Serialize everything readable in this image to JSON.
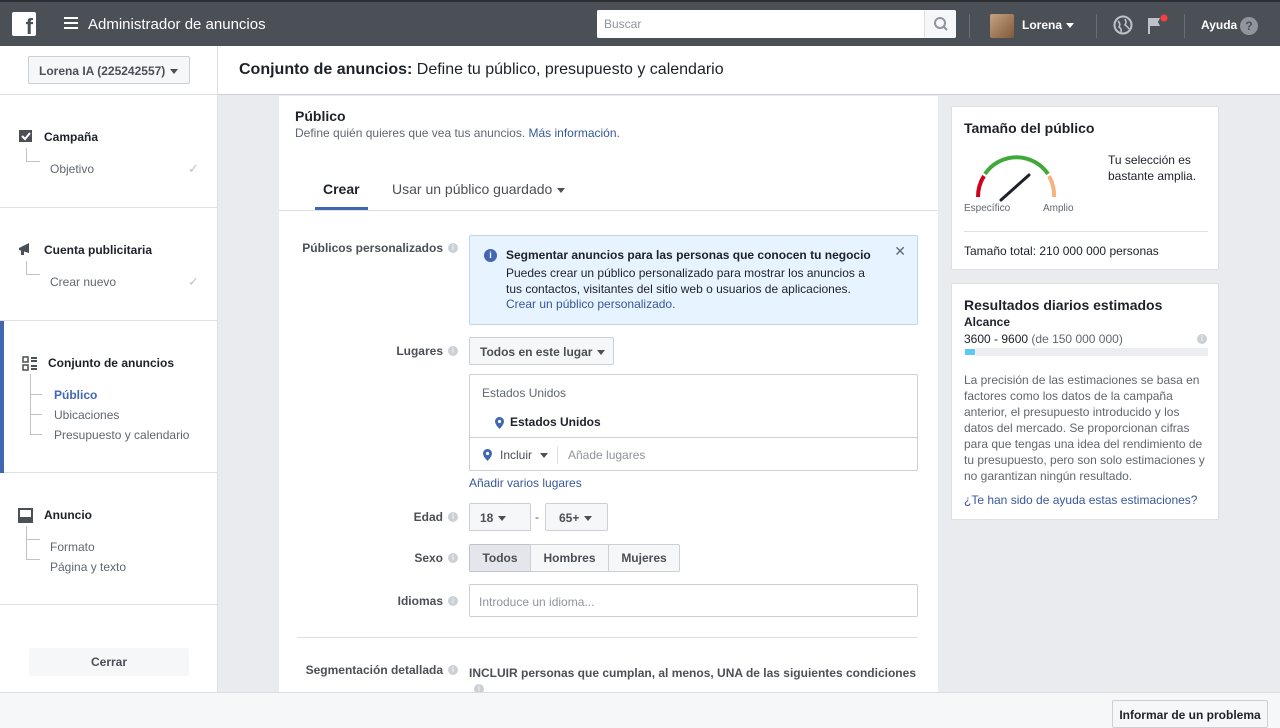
{
  "topbar": {
    "logo": "f",
    "title": "Administrador de anuncios",
    "search_placeholder": "Buscar",
    "user_name": "Lorena",
    "help_label": "Ayuda"
  },
  "sidebar": {
    "account": "Lorena IA (225242557)",
    "sections": [
      {
        "title": "Campaña",
        "items": [
          {
            "label": "Objetivo",
            "done": true
          }
        ]
      },
      {
        "title": "Cuenta publicitaria",
        "items": [
          {
            "label": "Crear nuevo",
            "done": true
          }
        ]
      },
      {
        "title": "Conjunto de anuncios",
        "items": [
          {
            "label": "Público",
            "active": true
          },
          {
            "label": "Ubicaciones"
          },
          {
            "label": "Presupuesto y calendario"
          }
        ]
      },
      {
        "title": "Anuncio",
        "items": [
          {
            "label": "Formato"
          },
          {
            "label": "Página y texto"
          }
        ]
      }
    ],
    "close_label": "Cerrar"
  },
  "header": {
    "title_bold": "Conjunto de anuncios:",
    "title_rest": " Define tu público, presupuesto y calendario"
  },
  "audience_form": {
    "title": "Público",
    "description": "Define quién quieres que vea tus anuncios.",
    "more_info": "Más información.",
    "tabs": [
      "Crear",
      "Usar un público guardado"
    ],
    "custom_audiences_label": "Públicos personalizados",
    "notice": {
      "title": "Segmentar anuncios para las personas que conocen tu negocio",
      "body": "Puedes crear un público personalizado para mostrar los anuncios a tus contactos, visitantes del sitio web o usuarios de aplicaciones.",
      "link": "Crear un público personalizado."
    },
    "locations_label": "Lugares",
    "locations_dropdown": "Todos en este lugar",
    "locations_header": "Estados Unidos",
    "location_item": "Estados Unidos",
    "include_label": "Incluir",
    "add_places_placeholder": "Añade lugares",
    "add_multiple": "Añadir varios lugares",
    "age_label": "Edad",
    "age_min": "18",
    "age_sep": "-",
    "age_max": "65+",
    "gender_label": "Sexo",
    "gender_options": [
      "Todos",
      "Hombres",
      "Mujeres"
    ],
    "gender_selected": "Todos",
    "languages_label": "Idiomas",
    "languages_placeholder": "Introduce un idioma...",
    "detailed_label": "Segmentación detallada",
    "detailed_text": "INCLUIR personas que cumplan, al menos, UNA de las siguientes condiciones"
  },
  "audience_size": {
    "title": "Tamaño del público",
    "label_specific": "Específico",
    "label_broad": "Amplio",
    "description": "Tu selección es bastante amplia.",
    "total": "Tamaño total: 210 000 000 personas"
  },
  "daily_results": {
    "title": "Resultados diarios estimados",
    "reach_label": "Alcance",
    "reach_value": "3600 - 9600",
    "reach_of": "(de 150 000 000)",
    "reach_fraction": 0.05,
    "explanation": "La precisión de las estimaciones se basa en factores como los datos de la campaña anterior, el presupuesto introducido y los datos del mercado. Se proporcionan cifras para que tengas una idea del rendimiento de tu presupuesto, pero son solo estimaciones y no garantizan ningún resultado.",
    "feedback_link": "¿Te han sido de ayuda estas estimaciones?"
  },
  "footer": {
    "report_label": "Informar de un problema"
  },
  "colors": {
    "accent": "#4267b2",
    "link": "#365899",
    "topbar": "#4b4f56"
  }
}
